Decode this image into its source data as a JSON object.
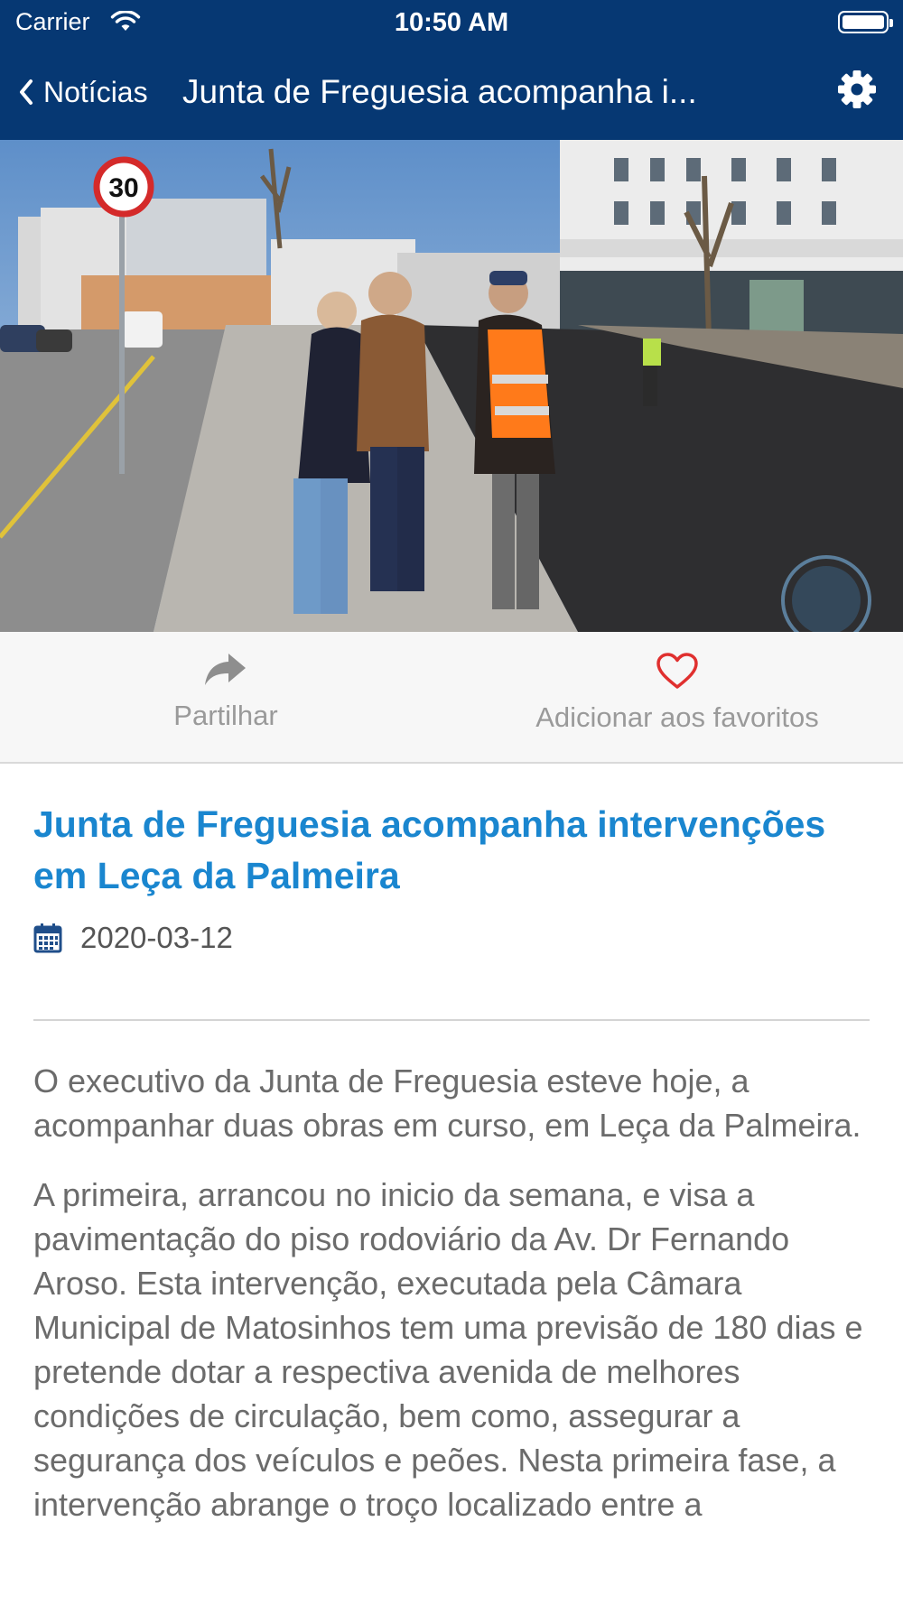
{
  "status_bar": {
    "carrier": "Carrier",
    "time": "10:50 AM"
  },
  "nav": {
    "back_label": "Notícias",
    "title": "Junta de Freguesia acompanha i...",
    "back_icon": "chevron-left-icon",
    "settings_icon": "gear-icon"
  },
  "hero_image": {
    "sign_text": "30"
  },
  "actions": {
    "share_label": "Partilhar",
    "share_icon": "share-arrow-icon",
    "favorite_label": "Adicionar aos favoritos",
    "favorite_icon": "heart-outline-icon"
  },
  "article": {
    "headline": "Junta de Freguesia acompanha intervenções em Leça da Palmeira",
    "date": "2020-03-12",
    "date_icon": "calendar-icon",
    "paragraphs": [
      "O executivo da Junta de Freguesia esteve hoje, a acompanhar duas obras em curso, em Leça da Palmeira.",
      "A primeira, arrancou no inicio da semana, e visa a pavimentação do piso rodoviário da Av. Dr Fernando Aroso. Esta intervenção, executada pela Câmara Municipal de Matosinhos tem uma previsão de 180 dias e pretende dotar a respectiva avenida de melhores condições de circulação, bem como, assegurar a segurança dos veículos e peões. Nesta primeira fase, a intervenção abrange o troço localizado entre a"
    ]
  },
  "colors": {
    "nav_background": "#063873",
    "headline": "#1a86cf",
    "favorite_heart": "#e0302f",
    "body_text": "#6b6b6b"
  }
}
